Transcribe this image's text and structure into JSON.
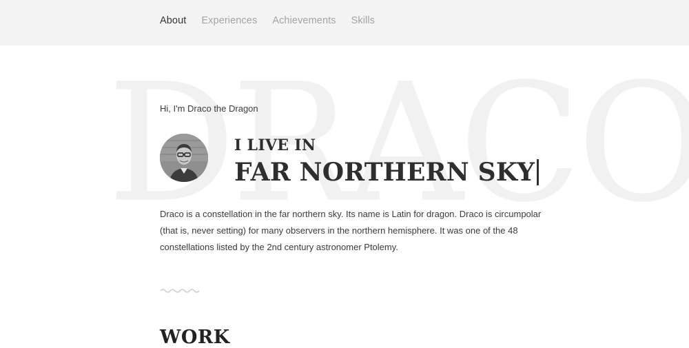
{
  "nav": {
    "items": [
      {
        "label": "About",
        "active": true
      },
      {
        "label": "Experiences",
        "active": false
      },
      {
        "label": "Achievements",
        "active": false
      },
      {
        "label": "Skills",
        "active": false
      }
    ]
  },
  "hero": {
    "background_word": "DRACO",
    "greeting": "Hi, I'm Draco the Dragon",
    "headline_small": "I LIVE IN",
    "headline_big": "FAR NORTHERN SKY",
    "description": "Draco is a constellation in the far northern sky. Its name is Latin for dragon. Draco is circumpolar (that is, never setting) for many observers in the northern hemisphere. It was one of the 48 constellations listed by the 2nd century astronomer Ptolemy."
  },
  "sections": {
    "work_heading": "WORK"
  },
  "colors": {
    "topbar_bg": "#f4f4f4",
    "nav_inactive": "#a3a3a3",
    "nav_active": "#333333",
    "text": "#2e2e2e",
    "background_word": "#f1f1f1",
    "squiggle": "#cfcfcf"
  },
  "icons": {
    "divider": "wavy-divider-icon",
    "avatar": "avatar-photo"
  }
}
